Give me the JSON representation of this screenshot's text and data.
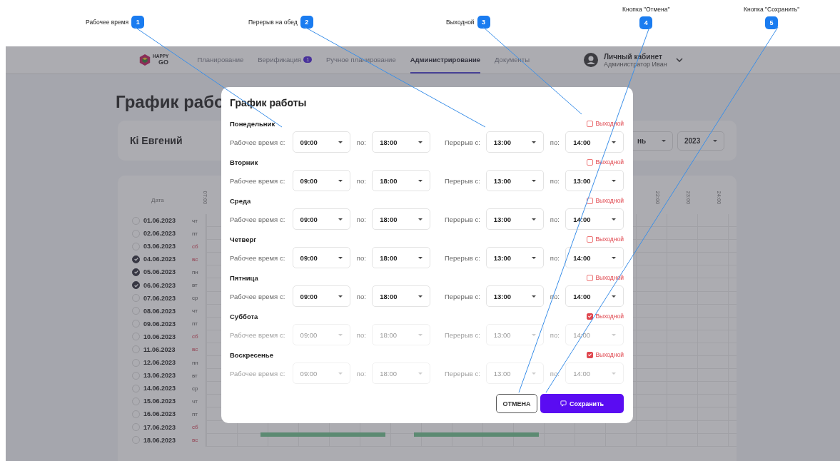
{
  "callouts": [
    {
      "number": "1",
      "label": "Рабочее время"
    },
    {
      "number": "2",
      "label": "Перерыв на обед"
    },
    {
      "number": "3",
      "label": "Выходной"
    },
    {
      "number": "4",
      "label": "Кнопка \"Отмена\""
    },
    {
      "number": "5",
      "label": "Кнопка \"Сохранить\""
    }
  ],
  "nav": {
    "logo": {
      "top": "HAPPY",
      "bottom": "GO"
    },
    "items": [
      {
        "label": "Планирование",
        "selected": false
      },
      {
        "label": "Верификация",
        "selected": false,
        "badge": "1"
      },
      {
        "label": "Ручное планирование",
        "selected": false
      },
      {
        "label": "Администрирование",
        "selected": true
      },
      {
        "label": "Документы",
        "selected": false
      }
    ],
    "user": {
      "title": "Личный кабинет",
      "subtitle": "Администратор Иван"
    }
  },
  "page": {
    "title": "График рабо",
    "employee": "Кі Евгений",
    "month_select": "нь",
    "year_select": "2023"
  },
  "grid": {
    "date_header": "Дата",
    "hours_left": [
      "07:00"
    ],
    "hours_right": [
      "22:00",
      "23:00",
      "24:00"
    ],
    "rows": [
      {
        "date": "01.06.2023",
        "weekday": "чт",
        "weekend": false,
        "checked": false
      },
      {
        "date": "02.06.2023",
        "weekday": "пт",
        "weekend": false,
        "checked": false
      },
      {
        "date": "03.06.2023",
        "weekday": "сб",
        "weekend": true,
        "checked": false
      },
      {
        "date": "04.06.2023",
        "weekday": "вс",
        "weekend": true,
        "checked": true
      },
      {
        "date": "05.06.2023",
        "weekday": "пн",
        "weekend": false,
        "checked": true
      },
      {
        "date": "06.06.2023",
        "weekday": "вт",
        "weekend": false,
        "checked": true
      },
      {
        "date": "07.06.2023",
        "weekday": "ср",
        "weekend": false,
        "checked": false
      },
      {
        "date": "08.06.2023",
        "weekday": "чт",
        "weekend": false,
        "checked": false
      },
      {
        "date": "09.06.2023",
        "weekday": "пт",
        "weekend": false,
        "checked": false
      },
      {
        "date": "10.06.2023",
        "weekday": "сб",
        "weekend": true,
        "checked": false
      },
      {
        "date": "11.06.2023",
        "weekday": "вс",
        "weekend": true,
        "checked": false
      },
      {
        "date": "12.06.2023",
        "weekday": "пн",
        "weekend": false,
        "checked": false
      },
      {
        "date": "13.06.2023",
        "weekday": "вт",
        "weekend": false,
        "checked": false
      },
      {
        "date": "14.06.2023",
        "weekday": "ср",
        "weekend": false,
        "checked": false
      },
      {
        "date": "15.06.2023",
        "weekday": "чт",
        "weekend": false,
        "checked": false
      },
      {
        "date": "16.06.2023",
        "weekday": "пт",
        "weekend": false,
        "checked": false
      },
      {
        "date": "17.06.2023",
        "weekday": "сб",
        "weekend": true,
        "checked": false
      },
      {
        "date": "18.06.2023",
        "weekday": "вс",
        "weekend": true,
        "checked": false
      }
    ]
  },
  "modal": {
    "title": "График работы",
    "days": [
      {
        "name": "Понедельник",
        "dayoff_label": "Выходной",
        "day_off": false,
        "work_label": "Рабочее время с:",
        "work_from": "09:00",
        "work_to_label": "по:",
        "work_to": "18:00",
        "break_label": "Перерыв с:",
        "break_from": "13:00",
        "break_to_label": "по:",
        "break_to": "14:00"
      },
      {
        "name": "Вторник",
        "dayoff_label": "Выходной",
        "day_off": false,
        "work_label": "Рабочее время с:",
        "work_from": "09:00",
        "work_to_label": "по:",
        "work_to": "18:00",
        "break_label": "Перерыв с:",
        "break_from": "13:00",
        "break_to_label": "по:",
        "break_to": "13:00"
      },
      {
        "name": "Среда",
        "dayoff_label": "Выходной",
        "day_off": false,
        "work_label": "Рабочее время с:",
        "work_from": "09:00",
        "work_to_label": "по:",
        "work_to": "18:00",
        "break_label": "Перерыв с:",
        "break_from": "13:00",
        "break_to_label": "по:",
        "break_to": "14:00"
      },
      {
        "name": "Четверг",
        "dayoff_label": "Выходной",
        "day_off": false,
        "work_label": "Рабочее время с:",
        "work_from": "09:00",
        "work_to_label": "по:",
        "work_to": "18:00",
        "break_label": "Перерыв с:",
        "break_from": "13:00",
        "break_to_label": "по:",
        "break_to": "14:00"
      },
      {
        "name": "Пятница",
        "dayoff_label": "Выходной",
        "day_off": false,
        "work_label": "Рабочее время с:",
        "work_from": "09:00",
        "work_to_label": "по:",
        "work_to": "18:00",
        "break_label": "Перерыв с:",
        "break_from": "13:00",
        "break_to_label": "по:",
        "break_to": "14:00"
      },
      {
        "name": "Суббота",
        "dayoff_label": "Выходной",
        "day_off": true,
        "work_label": "Рабочее время с:",
        "work_from": "09:00",
        "work_to_label": "по:",
        "work_to": "18:00",
        "break_label": "Перерыв с:",
        "break_from": "13:00",
        "break_to_label": "по:",
        "break_to": "14:00"
      },
      {
        "name": "Воскресенье",
        "dayoff_label": "Выходной",
        "day_off": true,
        "work_label": "Рабочее время с:",
        "work_from": "09:00",
        "work_to_label": "по:",
        "work_to": "18:00",
        "break_label": "Перерыв с:",
        "break_from": "13:00",
        "break_to_label": "по:",
        "break_to": "14:00"
      }
    ],
    "cancel": "ОТМЕНА",
    "save": "Сохранить"
  }
}
